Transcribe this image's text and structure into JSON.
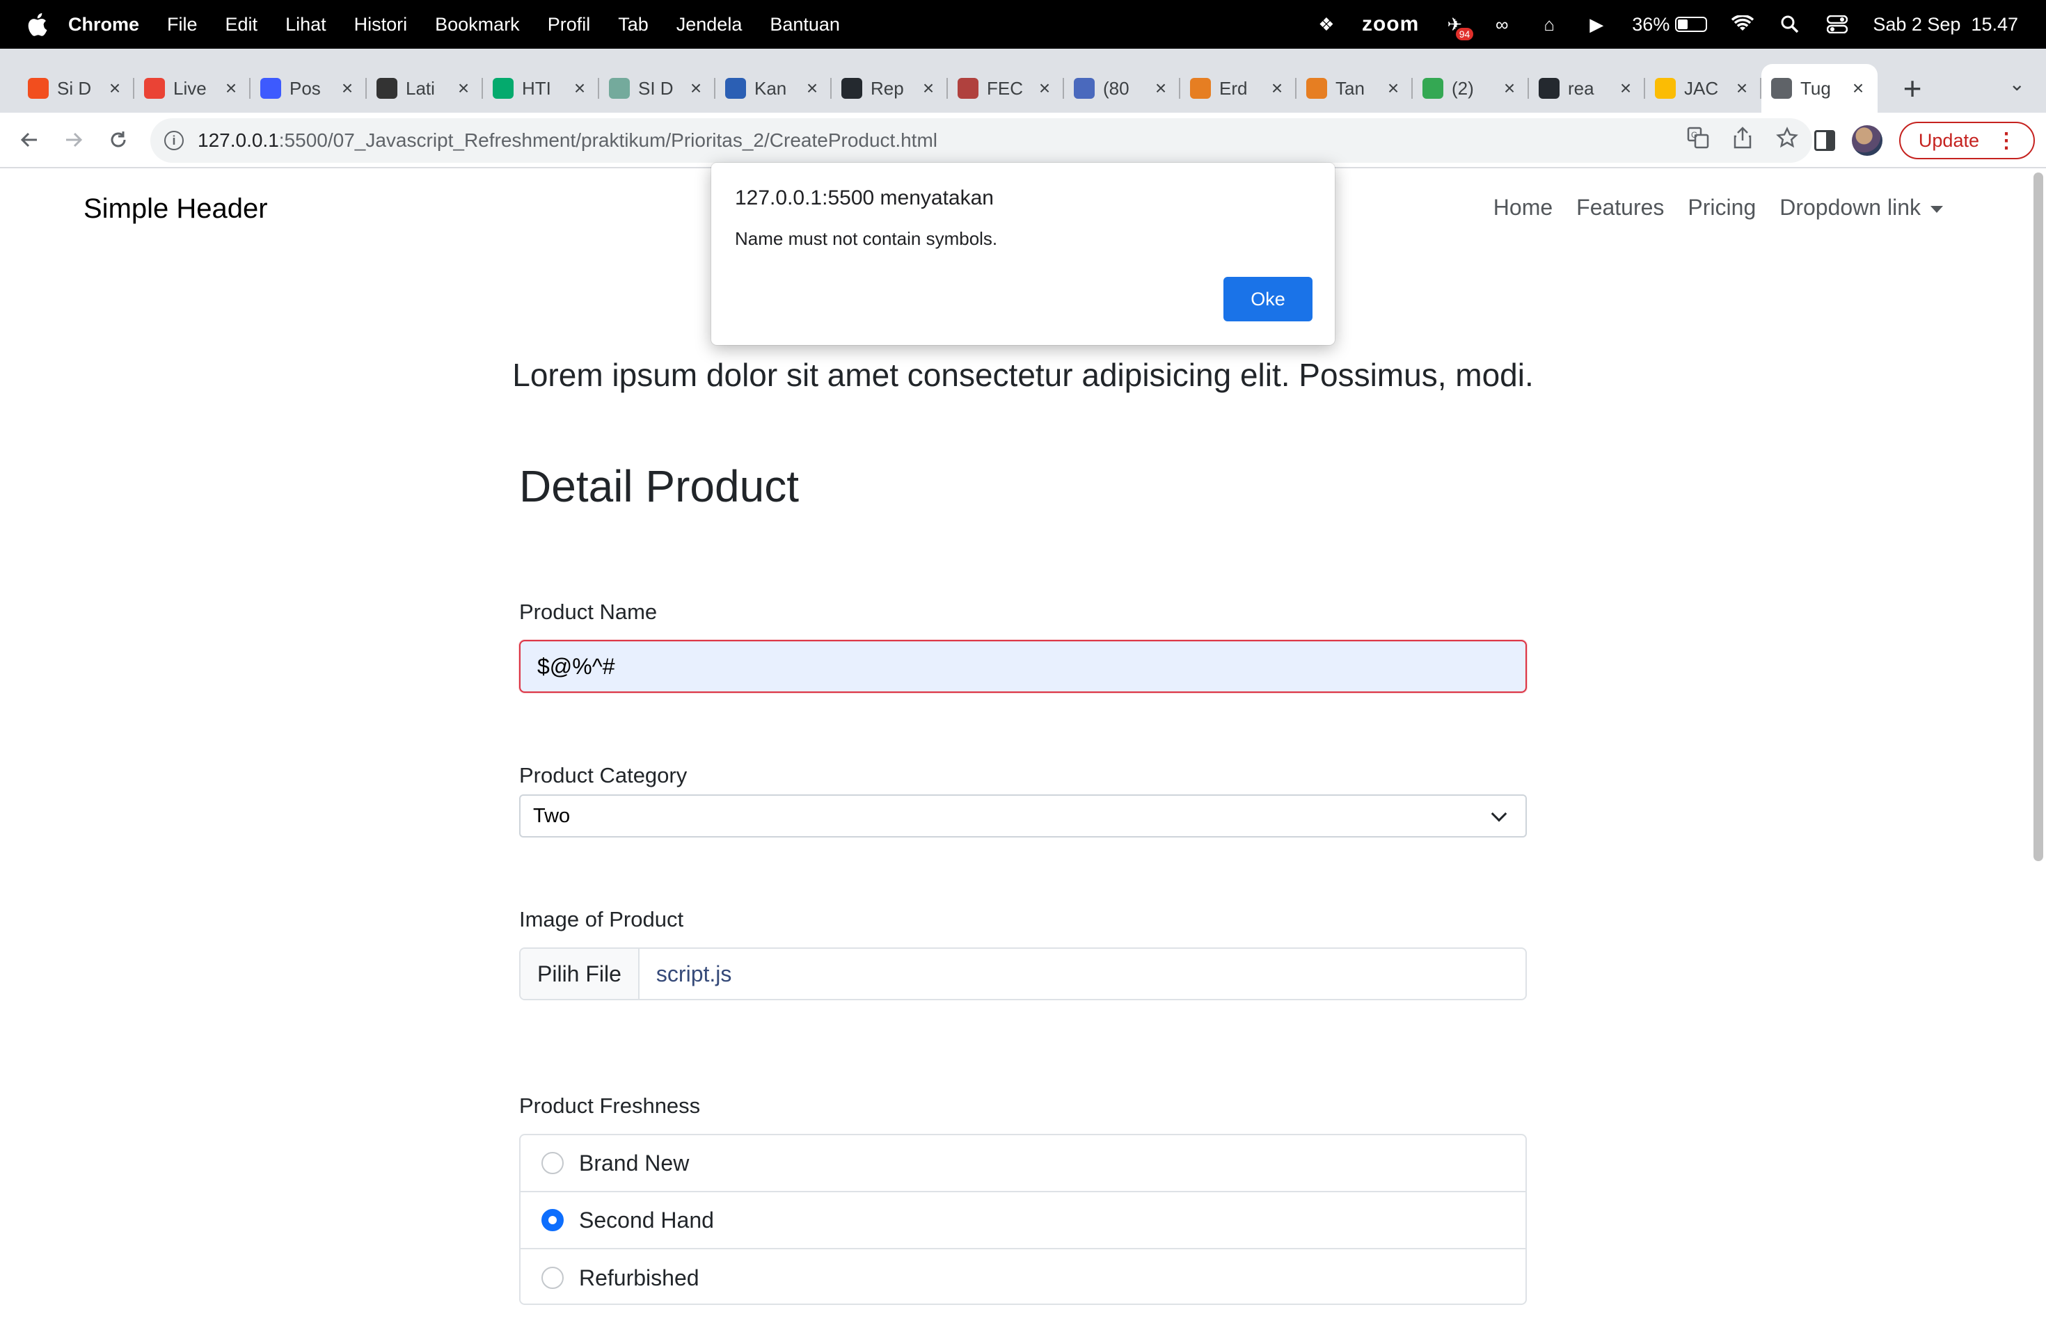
{
  "menubar": {
    "app_name": "Chrome",
    "items": [
      "File",
      "Edit",
      "Lihat",
      "Histori",
      "Bookmark",
      "Profil",
      "Tab",
      "Jendela",
      "Bantuan"
    ],
    "zoom_label": "zoom",
    "notification_badge": "94",
    "battery_percent": "36%",
    "battery_level": 0.36,
    "datetime": "Sab 2 Sep  15.47"
  },
  "tabs": [
    {
      "title": "Si D",
      "favicon_color": "#f24e1e",
      "icon": "figma-icon"
    },
    {
      "title": "Live",
      "favicon_color": "#ea4335",
      "icon": "gmail-icon"
    },
    {
      "title": "Pos",
      "favicon_color": "#3d5afe",
      "icon": "zenhub-icon"
    },
    {
      "title": "Lati",
      "favicon_color": "#333333",
      "icon": "onenote-icon"
    },
    {
      "title": "HTI",
      "favicon_color": "#04aa6d",
      "icon": "w3schools-icon"
    },
    {
      "title": "SI D",
      "favicon_color": "#74aa9c",
      "icon": "chatgpt-icon"
    },
    {
      "title": "Kan",
      "favicon_color": "#2b5fb4",
      "icon": "kampus-merdeka-icon"
    },
    {
      "title": "Rep",
      "favicon_color": "#24292f",
      "icon": "github-icon"
    },
    {
      "title": "FEC",
      "favicon_color": "#b0413e",
      "icon": "fec-icon"
    },
    {
      "title": "(80",
      "favicon_color": "#4a69bd",
      "icon": "notification-icon"
    },
    {
      "title": "Erd",
      "favicon_color": "#e67e22",
      "icon": "erd-icon"
    },
    {
      "title": "Tan",
      "favicon_color": "#e67e22",
      "icon": "erd-icon"
    },
    {
      "title": "(2)",
      "favicon_color": "#34a853",
      "icon": "whatsapp-icon"
    },
    {
      "title": "rea",
      "favicon_color": "#24292f",
      "icon": "github-icon"
    },
    {
      "title": "JAC",
      "favicon_color": "#fbbc04",
      "icon": "google-drive-icon"
    },
    {
      "title": "Tug",
      "favicon_color": "#5f6368",
      "icon": "globe-icon",
      "active": true
    }
  ],
  "toolbar": {
    "url_host": "127.0.0.1",
    "url_path": ":5500/07_Javascript_Refreshment/praktikum/Prioritas_2/CreateProduct.html",
    "update_label": "Update"
  },
  "site": {
    "brand": "Simple Header",
    "nav": [
      "Home",
      "Features",
      "Pricing",
      "Dropdown link"
    ],
    "lead": "Lorem ipsum dolor sit amet consectetur adipisicing elit. Possimus, modi."
  },
  "form": {
    "title": "Detail Product",
    "name_label": "Product Name",
    "name_value": "$@%^#",
    "category_label": "Product Category",
    "category_value": "Two",
    "image_label": "Image of Product",
    "file_button": "Pilih File",
    "file_name": "script.js",
    "freshness_label": "Product Freshness",
    "freshness_options": [
      {
        "label": "Brand New",
        "checked": false
      },
      {
        "label": "Second Hand",
        "checked": true
      },
      {
        "label": "Refurbished",
        "checked": false
      }
    ]
  },
  "dialog": {
    "title": "127.0.0.1:5500 menyatakan",
    "message": "Name must not contain symbols.",
    "ok_label": "Oke"
  }
}
